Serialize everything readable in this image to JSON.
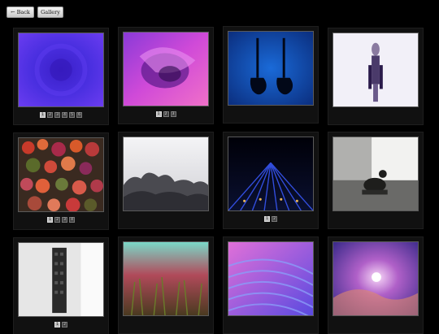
{
  "nav": {
    "back_label": "← Back",
    "gallery_label": "Gallery"
  },
  "cards": [
    {
      "name": "blue-swirl",
      "pages": [
        "1",
        "2",
        "3",
        "4",
        "5",
        "6"
      ],
      "current": 0
    },
    {
      "name": "pink-abstract",
      "pages": [
        "1",
        "2",
        "3"
      ],
      "current": 0
    },
    {
      "name": "guitars",
      "pages": [],
      "current": 0
    },
    {
      "name": "figure-sculpture",
      "pages": [],
      "current": 0
    },
    {
      "name": "autumn-leaves",
      "pages": [
        "1",
        "2",
        "3",
        "4"
      ],
      "current": 0
    },
    {
      "name": "clouds",
      "pages": [],
      "current": 0
    },
    {
      "name": "light-grid",
      "pages": [
        "1",
        "2"
      ],
      "current": 0
    },
    {
      "name": "duck-doorstop",
      "pages": [],
      "current": 0
    },
    {
      "name": "wall-panel",
      "pages": [
        "1",
        "2"
      ],
      "current": 0
    },
    {
      "name": "grass-closeup",
      "pages": [],
      "current": 0
    },
    {
      "name": "sand-dune",
      "pages": [],
      "current": 0
    },
    {
      "name": "sky-sun",
      "pages": [],
      "current": 0
    }
  ]
}
